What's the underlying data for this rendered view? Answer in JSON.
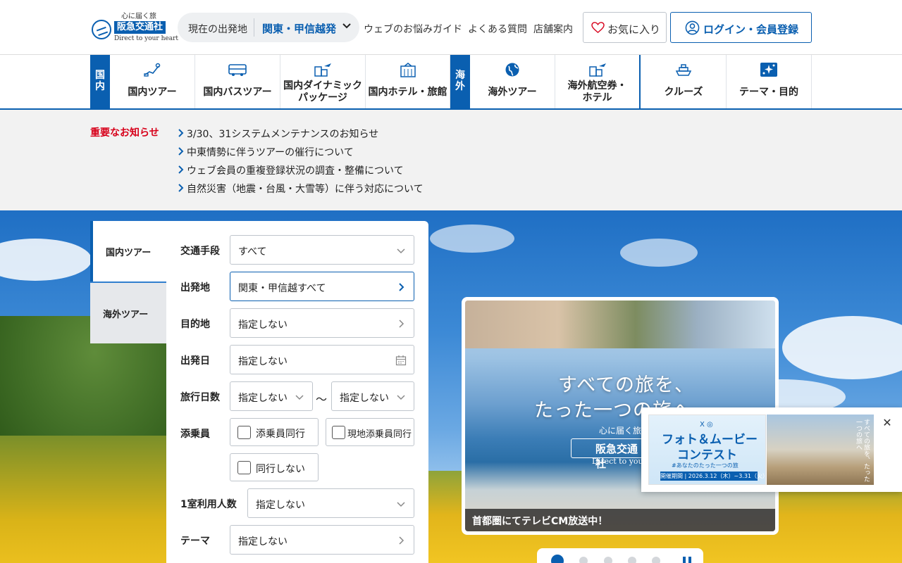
{
  "header": {
    "logo": {
      "tagline": "心に届く旅",
      "brand": "阪急交通社",
      "sub": "Direct to your heart"
    },
    "origin": {
      "label": "現在の出発地",
      "value": "関東・甲信越発"
    },
    "links": [
      "ウェブのお悩みガイド",
      "よくある質問",
      "店舗案内"
    ],
    "favorites_label": "お気に入り",
    "login_label": "ログイン・会員登録"
  },
  "nav": {
    "domestic_tag": "国内",
    "overseas_tag": "海外",
    "items": [
      {
        "label": "国内ツアー",
        "icon": "map-icon"
      },
      {
        "label": "国内バスツアー",
        "icon": "bus-icon"
      },
      {
        "label": "国内ダイナミック\nパッケージ",
        "icon": "plane-building-icon"
      },
      {
        "label": "国内ホテル・旅館",
        "icon": "hotel-icon"
      },
      {
        "label": "海外ツアー",
        "icon": "globe-icon"
      },
      {
        "label": "海外航空券・\nホテル",
        "icon": "plane-building-icon"
      },
      {
        "label": "クルーズ",
        "icon": "ship-icon"
      },
      {
        "label": "テーマ・目的",
        "icon": "sparkle-icon"
      }
    ]
  },
  "news": {
    "heading": "重要なお知らせ",
    "items": [
      "3/30、31システムメンテナンスのお知らせ",
      "中東情勢に伴うツアーの催行について",
      "ウェブ会員の重複登録状況の調査・整備について",
      "自然災害（地震・台風・大雪等）に伴う対応について"
    ]
  },
  "search": {
    "tabs": [
      "国内ツアー",
      "海外ツアー"
    ],
    "transport": {
      "label": "交通手段",
      "value": "すべて"
    },
    "departure": {
      "label": "出発地",
      "value": "関東・甲信越すべて"
    },
    "destination": {
      "label": "目的地",
      "value": "指定しない"
    },
    "date": {
      "label": "出発日",
      "value": "指定しない"
    },
    "days": {
      "label": "旅行日数",
      "from": "指定しない",
      "sep": "〜",
      "to": "指定しない"
    },
    "escort": {
      "label": "添乗員",
      "options": [
        "添乗員同行",
        "現地添乗員同行",
        "同行しない"
      ]
    },
    "room": {
      "label": "1室利用人数",
      "value": "指定しない"
    },
    "theme": {
      "label": "テーマ",
      "value": "指定しない"
    }
  },
  "banner": {
    "copy_line1": "すべての旅を、",
    "copy_line2": "たった一つの旅へ",
    "slogan": "心に届く旅",
    "brand": "阪急交通社",
    "brand_sub": "Direct to your heart",
    "caption": "首都圏にてテレビCM放送中！"
  },
  "popup": {
    "sns": "X ◎",
    "title_line1": "フォト＆ムービー",
    "title_line2": "コンテスト",
    "hashtag": "#あなたのたった一つの旅",
    "period": "開催期間 | 2026.3.12（木）~3.31（火）",
    "vertical_copy": "すべての旅を、たった一つの旅へ",
    "close": "✕"
  },
  "colors": {
    "brand": "#0a5fb0",
    "alert": "#d7001a"
  }
}
